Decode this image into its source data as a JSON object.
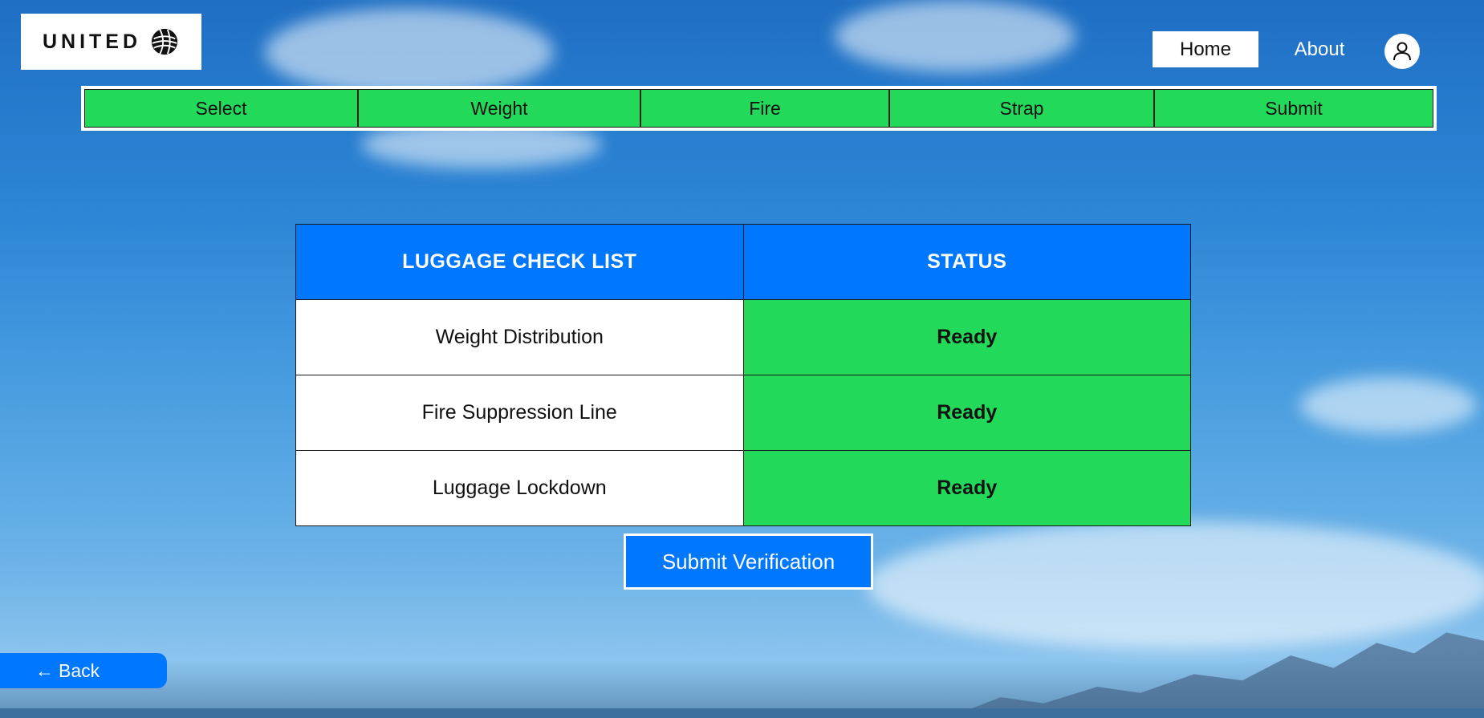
{
  "logo": {
    "text": "UNITED",
    "icon": "globe-icon"
  },
  "nav": {
    "home": "Home",
    "about": "About",
    "profile_icon": "user-icon"
  },
  "steps": [
    "Select",
    "Weight",
    "Fire",
    "Strap",
    "Submit"
  ],
  "checklist": {
    "headers": [
      "LUGGAGE CHECK LIST",
      "STATUS"
    ],
    "rows": [
      {
        "item": "Weight Distribution",
        "status": "Ready"
      },
      {
        "item": "Fire Suppression Line",
        "status": "Ready"
      },
      {
        "item": "Luggage Lockdown",
        "status": "Ready"
      }
    ]
  },
  "submit_label": "Submit Verification",
  "back": {
    "arrow": "←",
    "label": "Back"
  },
  "colors": {
    "accent_blue": "#0077ff",
    "ready_green": "#22d95a",
    "white": "#ffffff"
  }
}
